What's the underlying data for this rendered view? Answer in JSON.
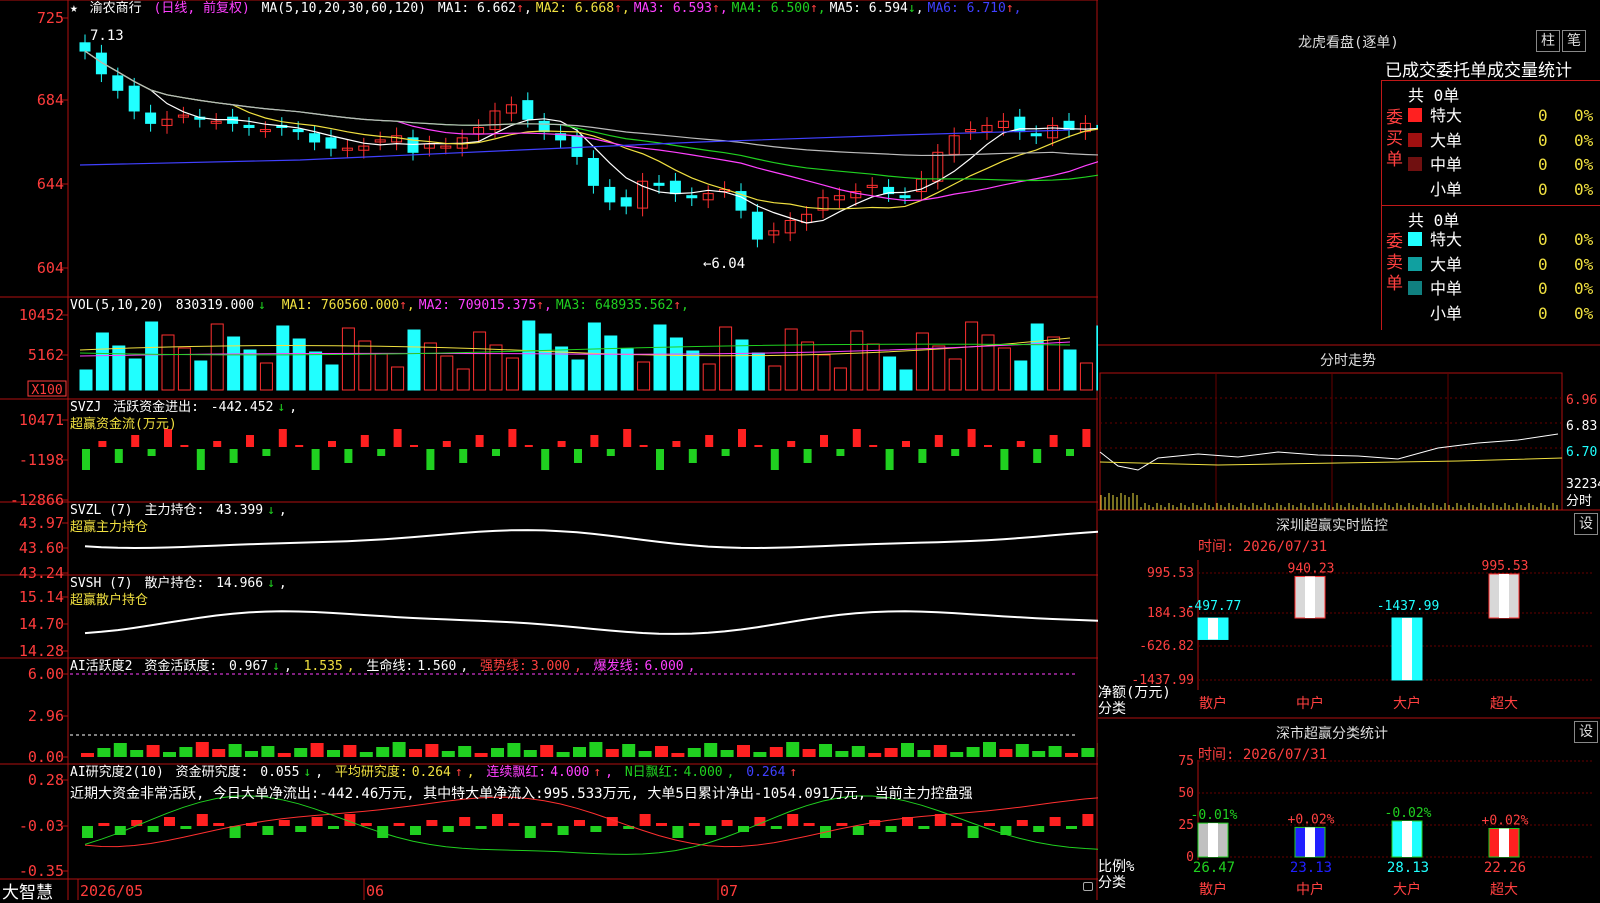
{
  "stock": {
    "name": "渝农商行",
    "period_note": "(日线, 前复权)",
    "ma_label": "MA(5,10,20,30,60,120)",
    "ma": [
      {
        "label": "MA1:",
        "value": "6.662",
        "arrow": "↑",
        "color": "#ffffff"
      },
      {
        "label": "MA2:",
        "value": "6.668",
        "arrow": "↑",
        "color": "#f0e040"
      },
      {
        "label": "MA3:",
        "value": "6.593",
        "arrow": "↑",
        "color": "#ff40ff"
      },
      {
        "label": "MA4:",
        "value": "6.500",
        "arrow": "↑",
        "color": "#20d020"
      },
      {
        "label": "MA5:",
        "value": "6.594",
        "arrow": "↓",
        "color": "#ffffff"
      },
      {
        "label": "MA6:",
        "value": "6.710",
        "arrow": "↑",
        "color": "#4040ff"
      }
    ],
    "high_marker": "7.13",
    "low_marker": "←6.04",
    "y_ticks": [
      "725",
      "684",
      "644",
      "604"
    ]
  },
  "volume": {
    "label": "VOL(5,10,20)",
    "value": "830319.000",
    "arrow": "↓",
    "ma": [
      {
        "label": "MA1:",
        "value": "760560.000",
        "arrow": "↑",
        "color": "#f0e040"
      },
      {
        "label": "MA2:",
        "value": "709015.375",
        "arrow": "↑",
        "color": "#ff40ff"
      },
      {
        "label": "MA3:",
        "value": "648935.562",
        "arrow": "↑",
        "color": "#20d020"
      }
    ],
    "y_ticks": [
      "10452",
      "5162"
    ],
    "unit": "X100"
  },
  "svzj": {
    "label": "SVZJ",
    "text": "活跃资金进出:",
    "value": "-442.452",
    "arrow": "↓",
    "subtitle": "超赢资金流(万元)",
    "y_ticks": [
      "10471",
      "-1198",
      "-12866"
    ]
  },
  "svzl": {
    "label": "SVZL (7)",
    "text": "主力持仓:",
    "value": "43.399",
    "arrow": "↓",
    "subtitle": "超赢主力持仓",
    "y_ticks": [
      "43.97",
      "43.60",
      "43.24"
    ]
  },
  "svsh": {
    "label": "SVSH (7)",
    "text": "散户持仓:",
    "value": "14.966",
    "arrow": "↓",
    "subtitle": "超赢散户持仓",
    "y_ticks": [
      "15.14",
      "14.70",
      "14.28"
    ]
  },
  "ai1": {
    "label": "AI活跃度2",
    "text": "资金活跃度:",
    "value": "0.967",
    "v2": "1.535",
    "life_label": "生命线:",
    "life": "1.560",
    "strong_label": "强势线:",
    "strong": "3.000",
    "burst_label": "爆发线:",
    "burst": "6.000",
    "y_ticks": [
      "6.00",
      "2.96",
      "0.00"
    ]
  },
  "ai2": {
    "label": "AI研究度2(10)",
    "text": "资金研究度:",
    "value": "0.055",
    "avg_label": "平均研究度:",
    "avg": "0.264",
    "red_label": "连续飘红:",
    "red": "4.000",
    "nred_label": "N日飘红:",
    "nred": "4.000",
    "nred2": "0.264",
    "note": "近期大资金非常活跃, 今日大单净流出:-442.46万元, 其中特大单净流入:995.533万元, 大单5日累计净出-1054.091万元, 当前主力控盘强",
    "y_ticks": [
      "0.28",
      "-0.03",
      "-0.35"
    ]
  },
  "xaxis": {
    "brand": "大智慧",
    "dates": [
      "2026/05",
      "06",
      "07"
    ]
  },
  "dragon": {
    "title": "龙虎看盘(逐单)",
    "btn1": "柱",
    "btn2": "笔",
    "subtitle": "已成交委托单成交量统计",
    "buy_label": "委买单",
    "sell_label": "委卖单",
    "buy_total": "共 0单",
    "sell_total": "共 0单",
    "buy_rows": [
      {
        "name": "特大",
        "count": "0",
        "pct": "0%",
        "color": "#ff2020"
      },
      {
        "name": "大单",
        "count": "0",
        "pct": "0%",
        "color": "#a01010"
      },
      {
        "name": "中单",
        "count": "0",
        "pct": "0%",
        "color": "#701010"
      },
      {
        "name": "小单",
        "count": "0",
        "pct": "0%",
        "color": ""
      }
    ],
    "sell_rows": [
      {
        "name": "特大",
        "count": "0",
        "pct": "0%",
        "color": "#20ffff"
      },
      {
        "name": "大单",
        "count": "0",
        "pct": "0%",
        "color": "#10a0a0"
      },
      {
        "name": "中单",
        "count": "0",
        "pct": "0%",
        "color": "#108080"
      },
      {
        "name": "小单",
        "count": "0",
        "pct": "0%",
        "color": ""
      }
    ]
  },
  "intraday": {
    "title": "分时走势",
    "y_ticks": [
      "6.96",
      "6.83",
      "6.70"
    ],
    "vol_label": "32234",
    "time_label": "分时"
  },
  "monitor": {
    "title": "深圳超赢实时监控",
    "btn": "设",
    "time": "时间: 2026/07/31",
    "y_ticks": [
      "995.53",
      "184.36",
      "-626.82",
      "-1437.99"
    ],
    "ylabel": "净额(万元)",
    "xlabel": "分类",
    "categories": [
      "散户",
      "中户",
      "大户",
      "超大"
    ]
  },
  "classify": {
    "title": "深市超赢分类统计",
    "btn": "设",
    "time": "时间: 2026/07/31",
    "y_ticks": [
      "75",
      "50",
      "25",
      "0"
    ],
    "ylabel": "比例%",
    "xlabel": "分类",
    "categories": [
      "散户",
      "中户",
      "大户",
      "超大"
    ]
  },
  "chart_data": [
    {
      "type": "bar",
      "title": "深圳超赢实时监控",
      "categories": [
        "散户",
        "中户",
        "大户",
        "超大"
      ],
      "values": [
        -497.77,
        940.23,
        -1437.99,
        995.53
      ],
      "value_labels": [
        "-497.77",
        "940.23",
        "-1437.99",
        "995.53"
      ],
      "ylabel": "净额(万元)",
      "xlabel": "分类",
      "ylim": [
        -1437.99,
        995.53
      ]
    },
    {
      "type": "bar",
      "title": "深市超赢分类统计",
      "categories": [
        "散户",
        "中户",
        "大户",
        "超大"
      ],
      "values": [
        26.47,
        23.13,
        28.13,
        22.26
      ],
      "value_labels": [
        "26.47",
        "23.13",
        "28.13",
        "22.26"
      ],
      "change_labels": [
        "-0.01%",
        "+0.02%",
        "-0.02%",
        "+0.02%"
      ],
      "ylabel": "比例%",
      "xlabel": "分类",
      "ylim": [
        0,
        75
      ]
    },
    {
      "type": "line",
      "title": "渝农商行 日线 收盘",
      "xlabel": "",
      "ylabel": "",
      "values": [
        7.09,
        6.98,
        6.9,
        6.8,
        6.74,
        6.76,
        6.78,
        6.76,
        6.75,
        6.74,
        6.72,
        6.71,
        6.72,
        6.7,
        6.65,
        6.62,
        6.62,
        6.63,
        6.66,
        6.68,
        6.6,
        6.64,
        6.63,
        6.67,
        6.72,
        6.8,
        6.83,
        6.76,
        6.7,
        6.66,
        6.58,
        6.44,
        6.36,
        6.34,
        6.46,
        6.44,
        6.4,
        6.38,
        6.4,
        6.42,
        6.32,
        6.18,
        6.22,
        6.27,
        6.3,
        6.38,
        6.39,
        6.41,
        6.44,
        6.4,
        6.39,
        6.47,
        6.6,
        6.68,
        6.71,
        6.73,
        6.75,
        6.7,
        6.68,
        6.73,
        6.71,
        6.74,
        6.72,
        6.69,
        6.67,
        6.66,
        6.69,
        6.68,
        6.66,
        6.72
      ],
      "ylim": [
        6.04,
        7.25
      ]
    }
  ]
}
